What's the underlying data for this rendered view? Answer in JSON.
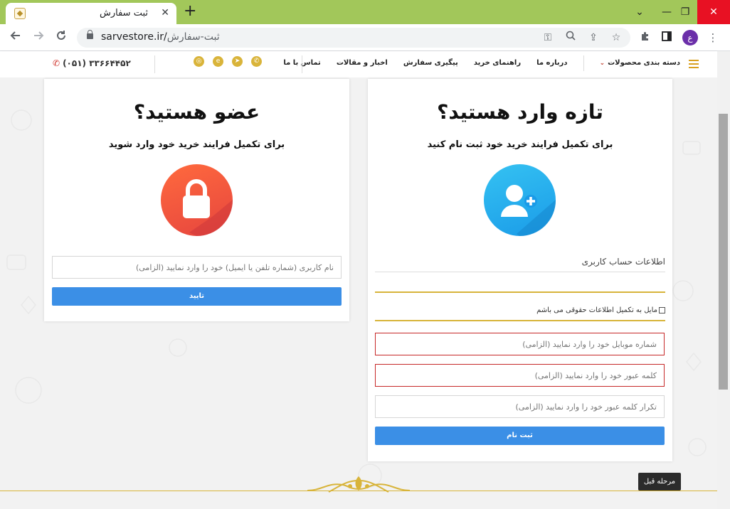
{
  "browser": {
    "tab_title": "ثبت سفارش",
    "tab_close": "✕",
    "new_tab": "+",
    "url_host": "sarvestore.ir/",
    "url_path": "ثبت-سفارش",
    "profile_initial": "ع",
    "window_controls": {
      "dropdown": "⌄",
      "minimize": "—",
      "restore": "❐",
      "close": "✕"
    }
  },
  "header": {
    "nav": {
      "categories": "دسته بندی محصولات",
      "about": "درباره ما",
      "guide": "راهنمای خرید",
      "tracking": "پیگیری سفارش",
      "news": "اخبار و مقالات",
      "contact": "تماس با ما"
    },
    "phone": "(۰۵۱) ۳۳۶۶۴۴۵۲",
    "socials": [
      "instagram-icon",
      "eitaa-icon",
      "telegram-icon",
      "whatsapp-icon"
    ]
  },
  "login_card": {
    "title": "عضو هستید؟",
    "subtitle": "برای تکمیل فرایند خرید خود وارد شوید",
    "username_placeholder": "نام کاربری (شماره تلفن یا ایمیل) خود را وارد نمایید (الزامی)",
    "submit": "تایید"
  },
  "register_card": {
    "title": "تازه وارد هستید؟",
    "subtitle": "برای تکمیل فرایند خرید خود ثبت نام کنید",
    "section_label": "اطلاعات حساب کاربری",
    "legal_checkbox": "مایل به تکمیل اطلاعات حقوقی می باشم",
    "mobile_placeholder": "شماره موبایل خود را وارد نمایید (الزامی)",
    "password_placeholder": "کلمه عبور خود را وارد نمایید (الزامی)",
    "password_repeat_placeholder": "تکرار کلمه عبور خود را وارد نمایید (الزامی)",
    "submit": "ثبت نام"
  },
  "footer": {
    "prev_step": "مرحله قبل"
  },
  "colors": {
    "chrome_frame": "#a2c75a",
    "gold_accent": "#d8b43a",
    "primary_button": "#3b8fe6",
    "error_border": "#c62828",
    "lock_circle": "#e6453f",
    "user_circle": "#1a9be8"
  }
}
